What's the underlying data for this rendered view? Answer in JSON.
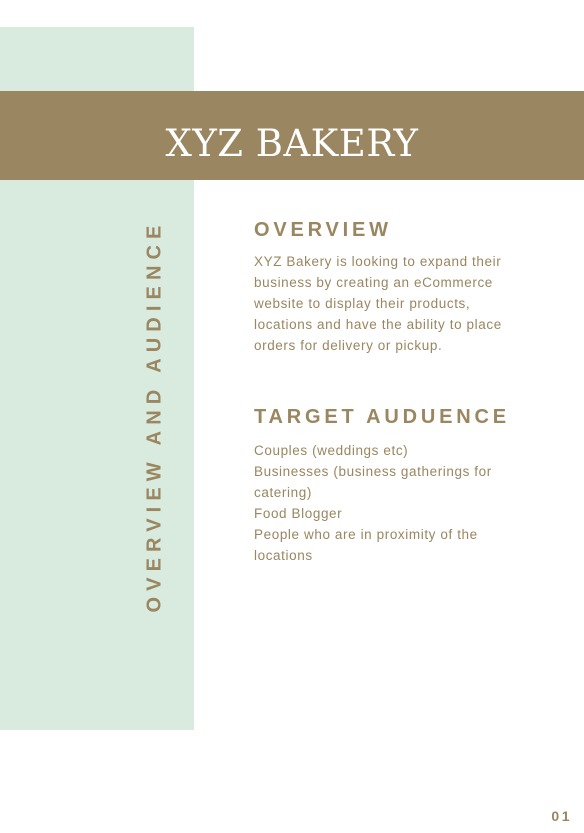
{
  "document": {
    "title": "XYZ BAKERY",
    "side_heading": "OVERVIEW AND AUDIENCE",
    "page_number": "01"
  },
  "overview": {
    "heading": "OVERVIEW",
    "text": "XYZ Bakery is looking to expand their business by creating an eCommerce website to display their products, locations and have the ability to place orders for delivery or pickup."
  },
  "target_audience": {
    "heading": "TARGET AUDUENCE",
    "items": [
      "Couples (weddings etc)",
      "Businesses (business gatherings for catering)",
      "Food Blogger",
      "People who are in proximity of the locations"
    ]
  },
  "colors": {
    "accent": "#9a8660",
    "side_panel": "#d9eadf",
    "background": "#ffffff",
    "title_text": "#ffffff"
  }
}
